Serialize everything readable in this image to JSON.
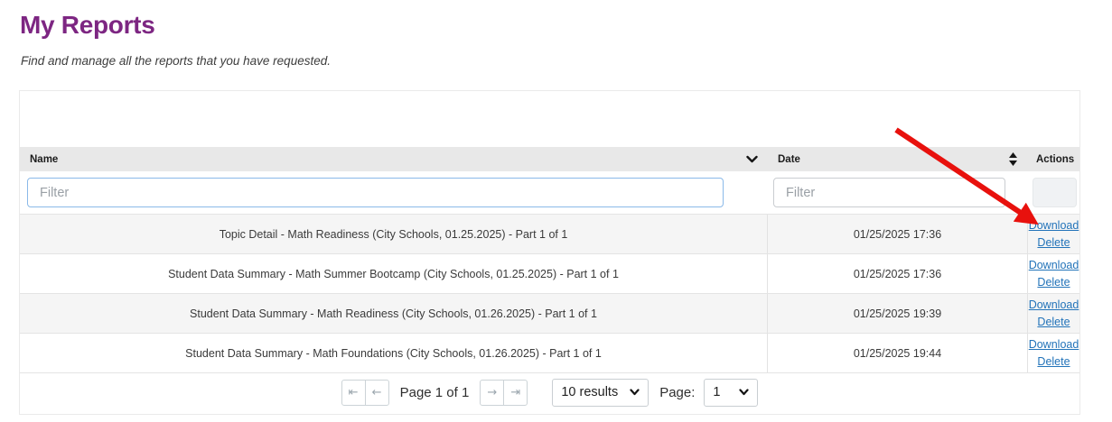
{
  "page": {
    "title": "My Reports",
    "subtitle": "Find and manage all the reports that you have requested."
  },
  "table": {
    "headers": {
      "name": "Name",
      "date": "Date",
      "actions": "Actions"
    },
    "sort_icons": {
      "name": "chevron-down-icon",
      "date": "sort-updown-icon"
    },
    "filters": {
      "name_placeholder": "Filter",
      "date_placeholder": "Filter"
    },
    "action_labels": {
      "download": "Download",
      "delete": "Delete"
    },
    "rows": [
      {
        "name": "Topic Detail - Math Readiness (City Schools, 01.25.2025) - Part 1 of 1",
        "date": "01/25/2025 17:36"
      },
      {
        "name": "Student Data Summary - Math Summer Bootcamp (City Schools, 01.25.2025) - Part 1 of 1",
        "date": "01/25/2025 17:36"
      },
      {
        "name": "Student Data Summary - Math Readiness (City Schools, 01.26.2025) - Part 1 of 1",
        "date": "01/25/2025 19:39"
      },
      {
        "name": "Student Data Summary - Math Foundations (City Schools, 01.26.2025) - Part 1 of 1",
        "date": "01/25/2025 19:44"
      }
    ]
  },
  "pagination": {
    "first_icon": "⇤",
    "prev_icon": "←",
    "next_icon": "→",
    "last_icon": "⇥",
    "page_info": "Page 1 of 1",
    "results_value": "10 results",
    "page_label": "Page:",
    "page_value": "1"
  },
  "annotation": {
    "type": "red-arrow",
    "points_to": "first-row-download-link"
  },
  "colors": {
    "accent": "#7d2682",
    "link": "#2273b9",
    "arrow": "#e8110d",
    "header_bg": "#e8e8e8",
    "row_alt_bg": "#f5f5f5"
  }
}
